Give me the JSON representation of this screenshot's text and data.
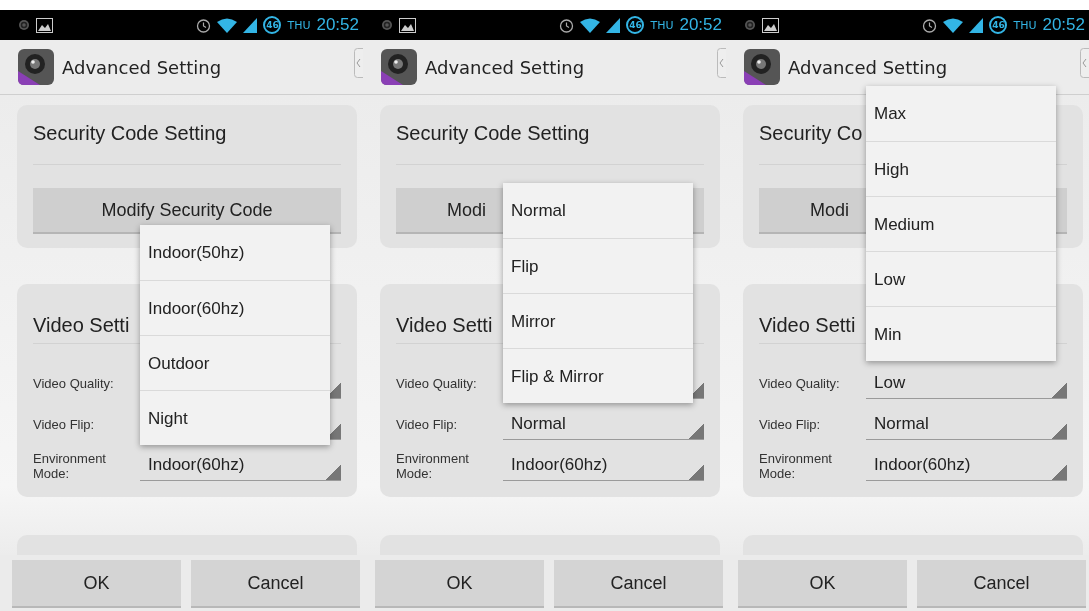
{
  "screens": [
    {
      "status_bar": {
        "battery": "46",
        "day": "THU",
        "time": "20:52"
      },
      "title": "Advanced Setting",
      "security": {
        "heading": "Security Code Setting",
        "button": "Modify Security Code"
      },
      "video": {
        "heading": "Video Setti",
        "rows": [
          {
            "label": "Video Quality:"
          },
          {
            "label": "Video Flip:"
          },
          {
            "label": "Environment Mode:",
            "value": "Indoor(60hz)"
          }
        ]
      },
      "popup": {
        "kind": "environment",
        "options": [
          "Indoor(50hz)",
          "Indoor(60hz)",
          "Outdoor",
          "Night"
        ]
      },
      "buttons": [
        "OK",
        "Cancel"
      ]
    },
    {
      "status_bar": {
        "battery": "46",
        "day": "THU",
        "time": "20:52"
      },
      "title": "Advanced Setting",
      "security": {
        "heading": "Security Code Setting",
        "button": "Modi"
      },
      "video": {
        "heading": "Video Setti",
        "rows": [
          {
            "label": "Video Quality:"
          },
          {
            "label": "Video Flip:",
            "value": "Normal"
          },
          {
            "label": "Environment Mode:",
            "value": "Indoor(60hz)"
          }
        ]
      },
      "popup": {
        "kind": "flip",
        "options": [
          "Normal",
          "Flip",
          "Mirror",
          "Flip & Mirror"
        ]
      },
      "buttons": [
        "OK",
        "Cancel"
      ]
    },
    {
      "status_bar": {
        "battery": "46",
        "day": "THU",
        "time": "20:52"
      },
      "title": "Advanced Setting",
      "security": {
        "heading": "Security Co",
        "button": "Modi"
      },
      "video": {
        "heading": "Video Setti",
        "rows": [
          {
            "label": "Video Quality:",
            "value": "Low"
          },
          {
            "label": "Video Flip:",
            "value": "Normal"
          },
          {
            "label": "Environment Mode:",
            "value": "Indoor(60hz)"
          }
        ]
      },
      "popup": {
        "kind": "quality",
        "options": [
          "Max",
          "High",
          "Medium",
          "Low",
          "Min"
        ]
      },
      "buttons": [
        "OK",
        "Cancel"
      ]
    }
  ]
}
